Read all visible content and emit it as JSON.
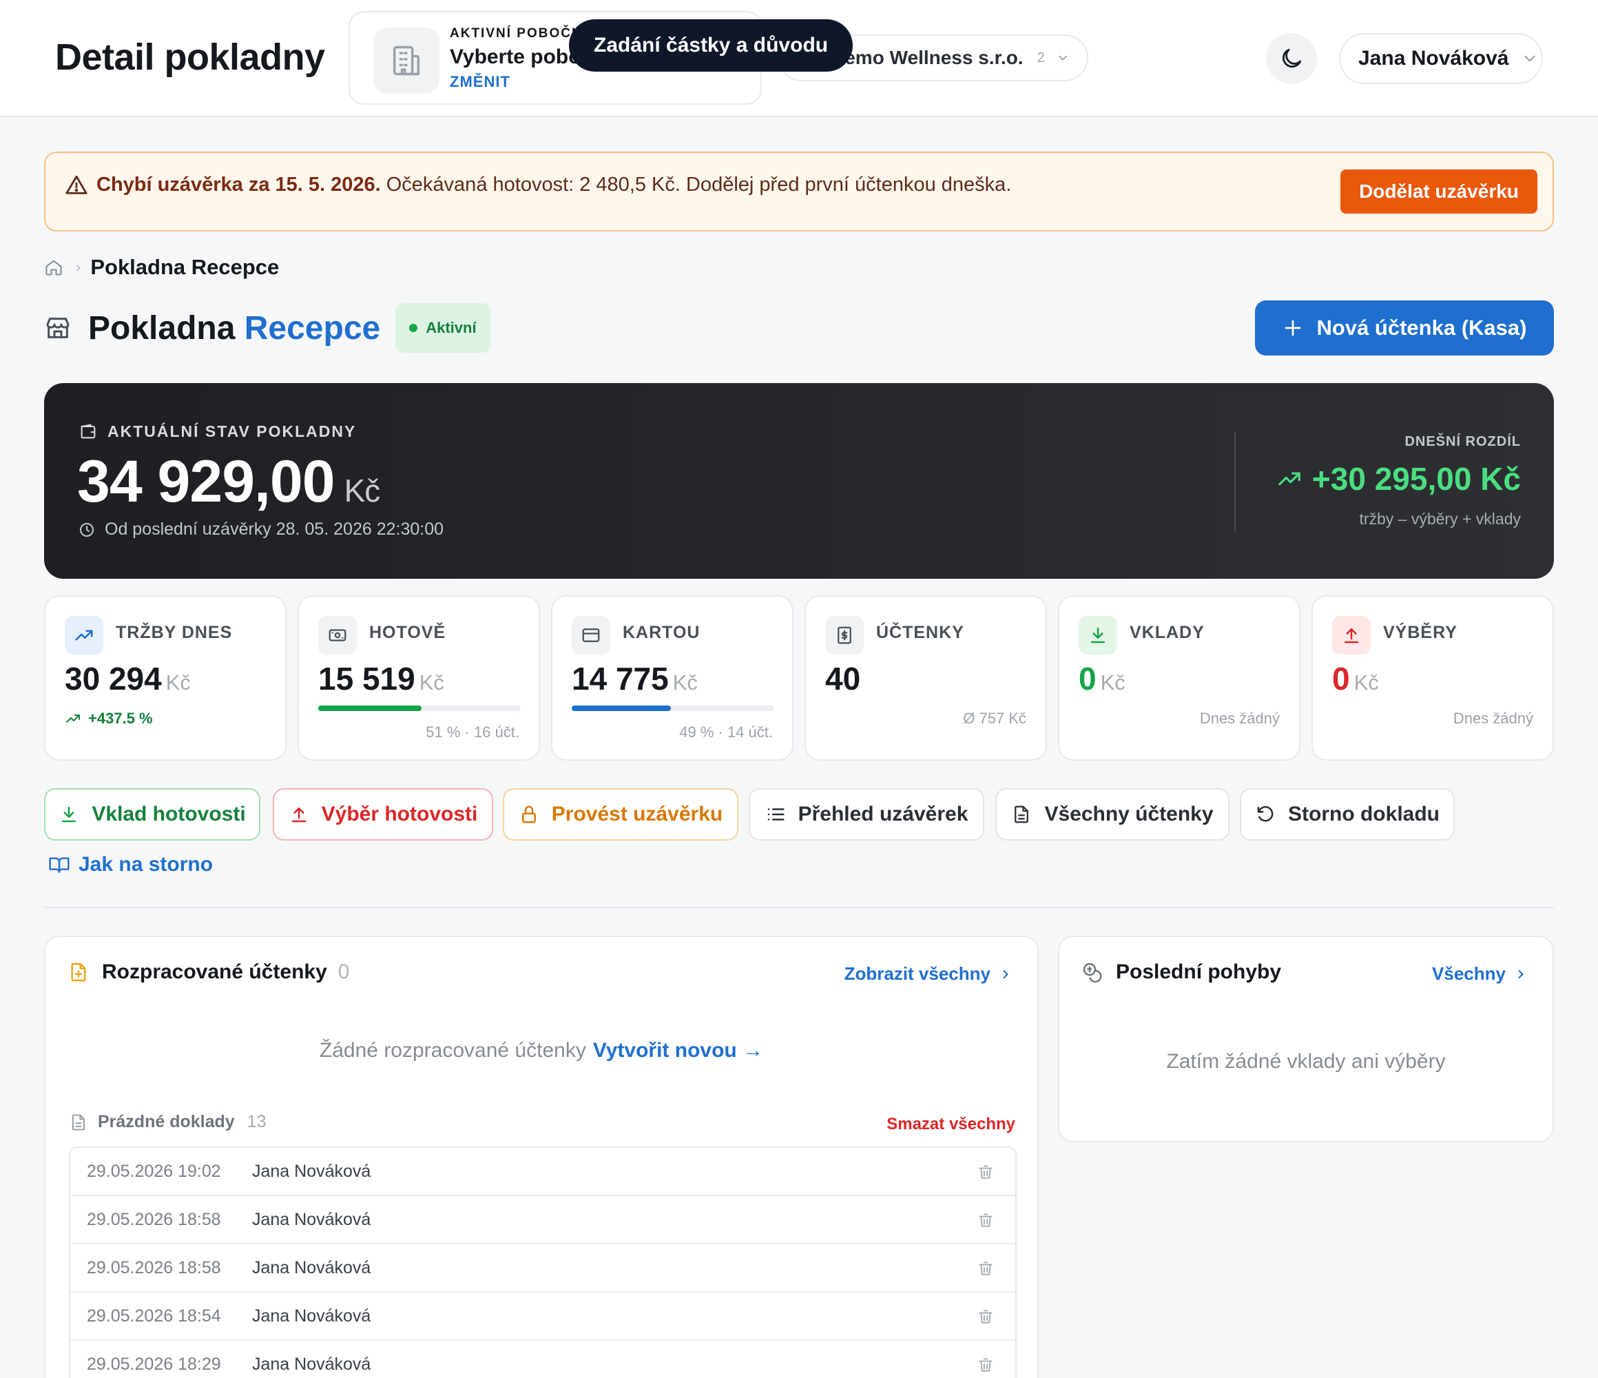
{
  "header": {
    "title": "Detail pokladny",
    "branch": {
      "kicker": "AKTIVNÍ POBOČKA",
      "value": "Vyberte pobočku",
      "change_label": "ZMĚNIT"
    },
    "tooltip": "Zadání částky a důvodu",
    "company": {
      "name": "Demo Wellness s.r.o.",
      "count": "2"
    },
    "user": {
      "name": "Jana Nováková"
    }
  },
  "alert": {
    "bold": "Chybí uzávěrka za 15. 5. 2026.",
    "text": " Očekávaná hotovost: 2 480,5 Kč. Dodělej před první účtenkou dneška.",
    "button": "Dodělat uzávěrku"
  },
  "breadcrumb": {
    "current": "Pokladna Recepce"
  },
  "cashdesk": {
    "title_prefix": "Pokladna",
    "title_name": "Recepce",
    "status": "Aktivní",
    "new_receipt": "Nová účtenka (Kasa)"
  },
  "balance": {
    "kicker": "AKTUÁLNÍ STAV POKLADNY",
    "amount": "34 929,00",
    "currency": "Kč",
    "since": "Od poslední uzávěrky 28. 05. 2026 22:30:00",
    "diff_kicker": "DNEŠNÍ ROZDÍL",
    "diff_amount": "+30 295,00 Kč",
    "diff_note": "tržby – výběry + vklady"
  },
  "stats": {
    "sales": {
      "label": "TRŽBY DNES",
      "value": "30 294",
      "currency": "Kč",
      "change": "+437.5 %"
    },
    "cash": {
      "label": "HOTOVĚ",
      "value": "15 519",
      "currency": "Kč",
      "share": 0.51,
      "note": "51 % · 16 účt."
    },
    "card": {
      "label": "KARTOU",
      "value": "14 775",
      "currency": "Kč",
      "share": 0.49,
      "note": "49 % · 14 účt."
    },
    "receipts": {
      "label": "ÚČTENKY",
      "value": "40",
      "note": "Ø 757 Kč"
    },
    "deposits": {
      "label": "VKLADY",
      "value": "0",
      "currency": "Kč",
      "note": "Dnes žádný"
    },
    "withdrawals": {
      "label": "VÝBĚRY",
      "value": "0",
      "currency": "Kč",
      "note": "Dnes žádný"
    }
  },
  "actions": {
    "deposit": "Vklad hotovosti",
    "withdraw": "Výběr hotovosti",
    "closing": "Provést uzávěrku",
    "closings_overview": "Přehled uzávěrek",
    "all_receipts": "Všechny účtenky",
    "void": "Storno dokladu",
    "howto_void": "Jak na storno"
  },
  "drafts": {
    "title": "Rozpracované účtenky",
    "count": "0",
    "show_all": "Zobrazit všechny",
    "empty": "Žádné rozpracované účtenky",
    "create_new": "Vytvořit novou →",
    "empty_docs_title": "Prázdné doklady",
    "empty_docs_count": "13",
    "delete_all": "Smazat všechny",
    "rows": [
      {
        "datetime": "29.05.2026 19:02",
        "user": "Jana Nováková"
      },
      {
        "datetime": "29.05.2026 18:58",
        "user": "Jana Nováková"
      },
      {
        "datetime": "29.05.2026 18:58",
        "user": "Jana Nováková"
      },
      {
        "datetime": "29.05.2026 18:54",
        "user": "Jana Nováková"
      },
      {
        "datetime": "29.05.2026 18:29",
        "user": "Jana Nováková"
      }
    ]
  },
  "movements": {
    "title": "Poslední pohyby",
    "all_link": "Všechny",
    "empty": "Zatím žádné vklady ani výběry"
  },
  "colors": {
    "accent": "#1f6fcf",
    "success": "#16a34a",
    "danger": "#dc2626",
    "warning": "#ea580c",
    "gold": "#d97706"
  }
}
